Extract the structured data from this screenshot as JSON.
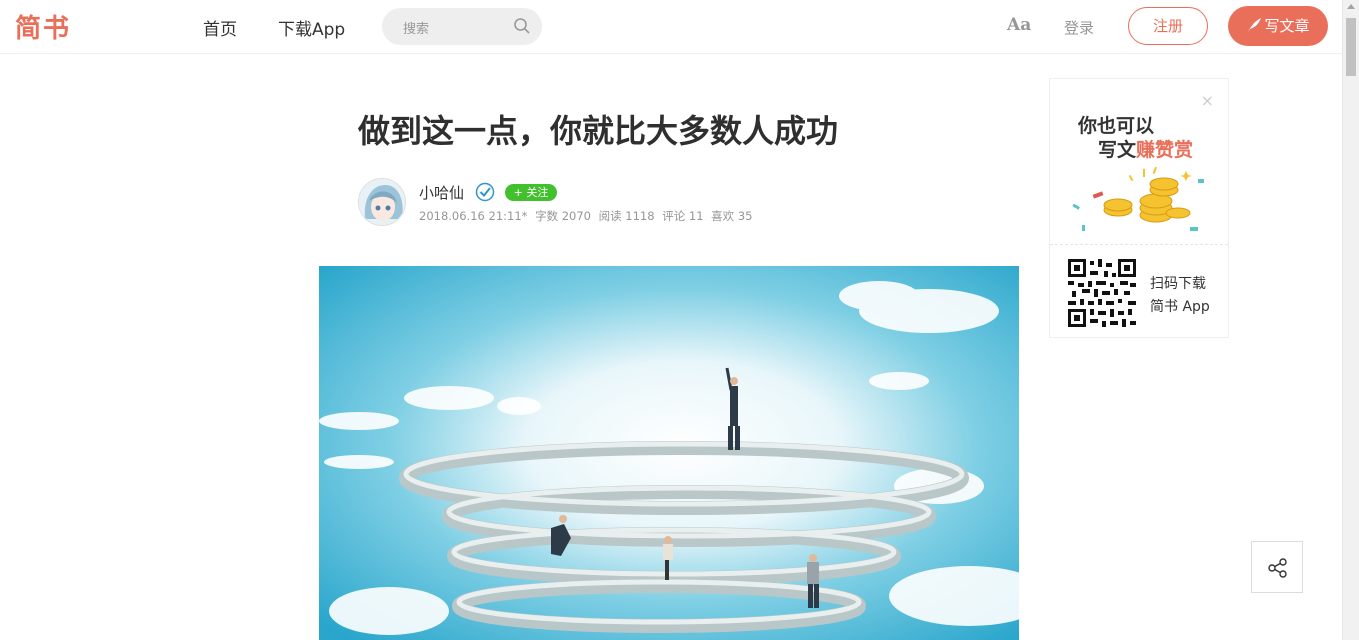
{
  "nav": {
    "logo": "简书",
    "home": "首页",
    "download_app": "下载App",
    "search_placeholder": "搜索",
    "font_toggle": "Aa",
    "login": "登录",
    "register": "注册",
    "write": "写文章"
  },
  "article": {
    "title": "做到这一点，你就比大多数人成功",
    "author": "小哈仙",
    "follow": "+ 关注",
    "date": "2018.06.16 21:11*",
    "word_count": "字数 2070",
    "reads": "阅读 1118",
    "comments": "评论 11",
    "likes": "喜欢 35"
  },
  "ad": {
    "line1": "你也可以",
    "line2_prefix": "写文",
    "line2_highlight": "赚赞赏",
    "scan_line1": "扫码下载",
    "scan_line2": "简书 App",
    "close": "×"
  },
  "colors": {
    "brand": "#ea6f5a",
    "follow": "#42c02e"
  }
}
